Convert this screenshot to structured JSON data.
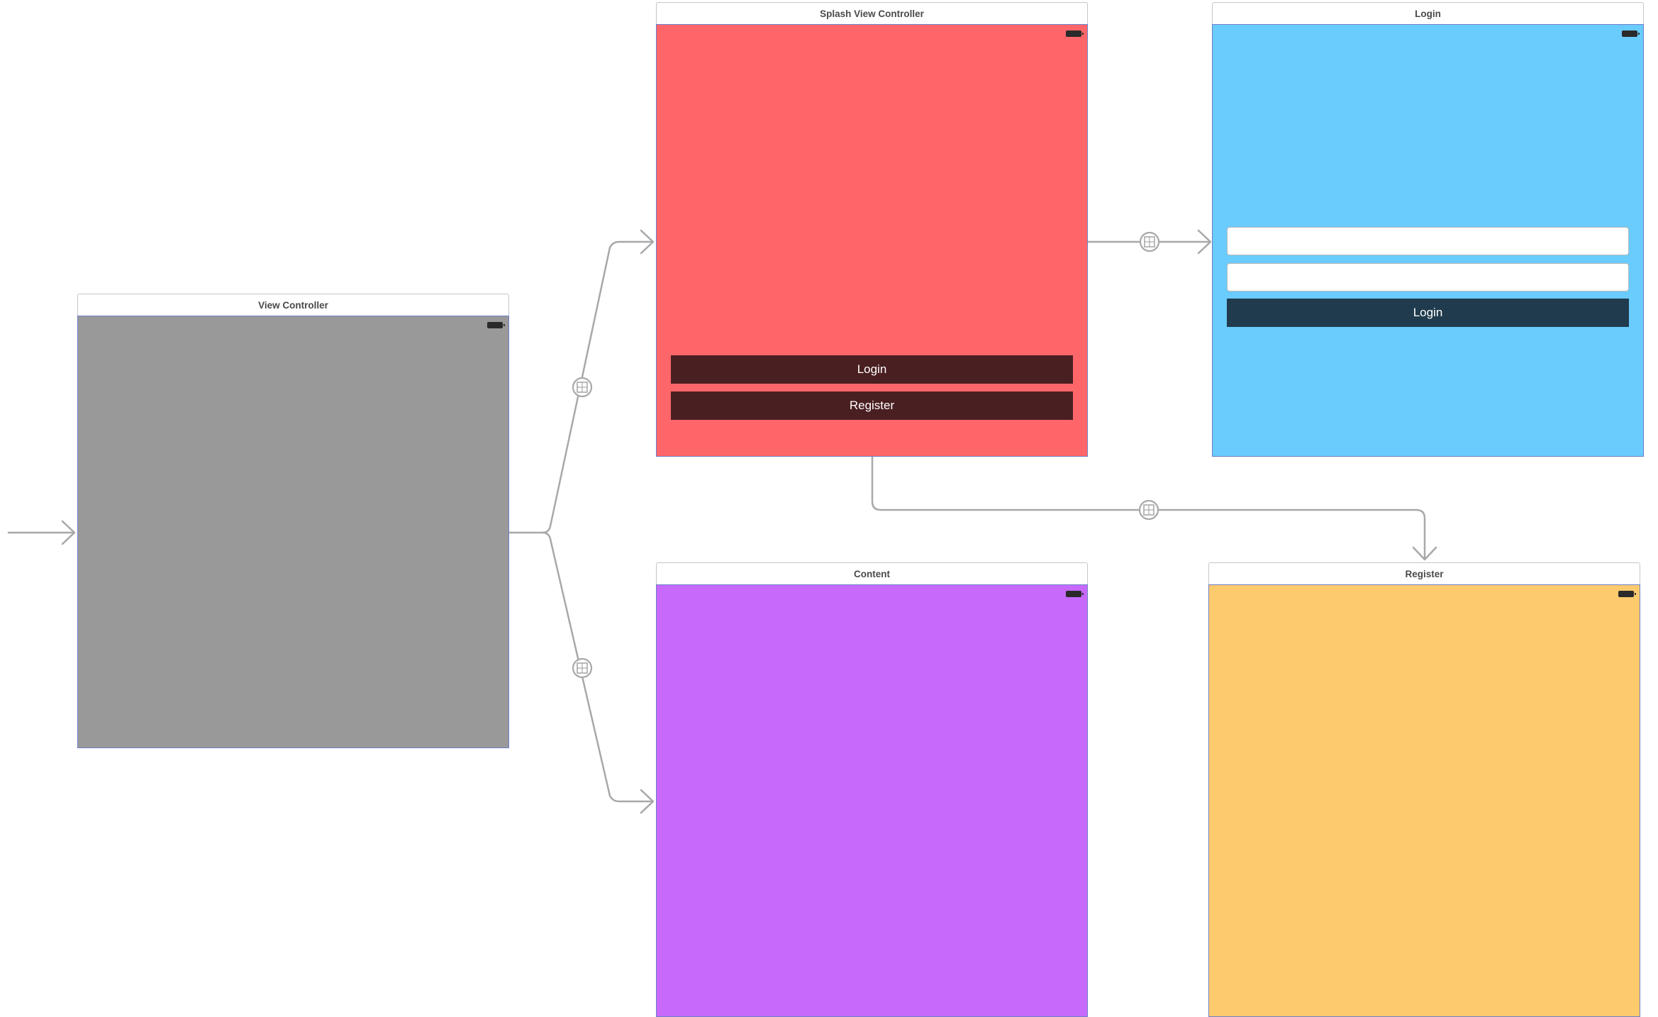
{
  "storyboard": {
    "scenes": {
      "view_controller": {
        "title": "View Controller",
        "background": "#999999"
      },
      "splash": {
        "title": "Splash View Controller",
        "background": "#ff6669",
        "login_button": "Login",
        "register_button": "Register",
        "button_color": "#4a1f22"
      },
      "login": {
        "title": "Login",
        "background": "#6acbfd",
        "username_field": {
          "value": "",
          "placeholder": ""
        },
        "password_field": {
          "value": "",
          "placeholder": ""
        },
        "login_button": "Login",
        "button_color": "#1f3b4d"
      },
      "content": {
        "title": "Content",
        "background": "#c76afb"
      },
      "register": {
        "title": "Register",
        "background": "#fdca6e"
      }
    },
    "segue_color": "#a8a8a8",
    "segue_icon": "segue-icon",
    "status_icon": "battery-icon",
    "entry_point_icon": "initial-arrow-icon"
  }
}
